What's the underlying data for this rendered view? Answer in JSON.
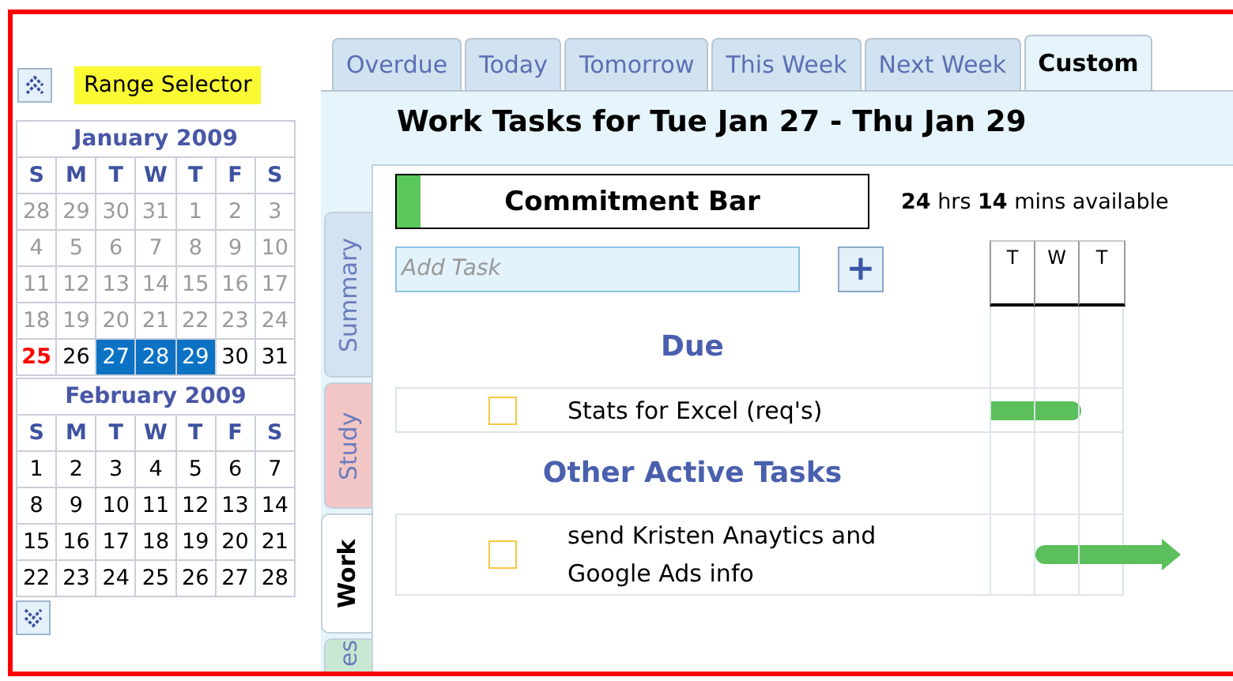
{
  "range_selector": {
    "label": "Range Selector"
  },
  "calendar": {
    "months": [
      {
        "title": "January 2009",
        "weekdays": [
          "S",
          "M",
          "T",
          "W",
          "T",
          "F",
          "S"
        ],
        "weeks": [
          [
            {
              "day": "28",
              "kind": "past",
              "selected": false
            },
            {
              "day": "29",
              "kind": "past",
              "selected": false
            },
            {
              "day": "30",
              "kind": "past",
              "selected": false
            },
            {
              "day": "31",
              "kind": "past",
              "selected": false
            },
            {
              "day": "1",
              "kind": "past",
              "selected": false
            },
            {
              "day": "2",
              "kind": "past",
              "selected": false
            },
            {
              "day": "3",
              "kind": "past",
              "selected": false
            }
          ],
          [
            {
              "day": "4",
              "kind": "past",
              "selected": false
            },
            {
              "day": "5",
              "kind": "past",
              "selected": false
            },
            {
              "day": "6",
              "kind": "past",
              "selected": false
            },
            {
              "day": "7",
              "kind": "past",
              "selected": false
            },
            {
              "day": "8",
              "kind": "past",
              "selected": false
            },
            {
              "day": "9",
              "kind": "past",
              "selected": false
            },
            {
              "day": "10",
              "kind": "past",
              "selected": false
            }
          ],
          [
            {
              "day": "11",
              "kind": "past",
              "selected": false
            },
            {
              "day": "12",
              "kind": "past",
              "selected": false
            },
            {
              "day": "13",
              "kind": "past",
              "selected": false
            },
            {
              "day": "14",
              "kind": "past",
              "selected": false
            },
            {
              "day": "15",
              "kind": "past",
              "selected": false
            },
            {
              "day": "16",
              "kind": "past",
              "selected": false
            },
            {
              "day": "17",
              "kind": "past",
              "selected": false
            }
          ],
          [
            {
              "day": "18",
              "kind": "past",
              "selected": false
            },
            {
              "day": "19",
              "kind": "past",
              "selected": false
            },
            {
              "day": "20",
              "kind": "past",
              "selected": false
            },
            {
              "day": "21",
              "kind": "past",
              "selected": false
            },
            {
              "day": "22",
              "kind": "past",
              "selected": false
            },
            {
              "day": "23",
              "kind": "past",
              "selected": false
            },
            {
              "day": "24",
              "kind": "past",
              "selected": false
            }
          ],
          [
            {
              "day": "25",
              "kind": "today",
              "selected": false
            },
            {
              "day": "26",
              "kind": "normal",
              "selected": false
            },
            {
              "day": "27",
              "kind": "normal",
              "selected": true
            },
            {
              "day": "28",
              "kind": "normal",
              "selected": true
            },
            {
              "day": "29",
              "kind": "normal",
              "selected": true
            },
            {
              "day": "30",
              "kind": "normal",
              "selected": false
            },
            {
              "day": "31",
              "kind": "normal",
              "selected": false
            }
          ]
        ]
      },
      {
        "title": "February 2009",
        "weekdays": [
          "S",
          "M",
          "T",
          "W",
          "T",
          "F",
          "S"
        ],
        "weeks": [
          [
            {
              "day": "1",
              "kind": "normal",
              "selected": false
            },
            {
              "day": "2",
              "kind": "normal",
              "selected": false
            },
            {
              "day": "3",
              "kind": "normal",
              "selected": false
            },
            {
              "day": "4",
              "kind": "normal",
              "selected": false
            },
            {
              "day": "5",
              "kind": "normal",
              "selected": false
            },
            {
              "day": "6",
              "kind": "normal",
              "selected": false
            },
            {
              "day": "7",
              "kind": "normal",
              "selected": false
            }
          ],
          [
            {
              "day": "8",
              "kind": "normal",
              "selected": false
            },
            {
              "day": "9",
              "kind": "normal",
              "selected": false
            },
            {
              "day": "10",
              "kind": "normal",
              "selected": false
            },
            {
              "day": "11",
              "kind": "normal",
              "selected": false
            },
            {
              "day": "12",
              "kind": "normal",
              "selected": false
            },
            {
              "day": "13",
              "kind": "normal",
              "selected": false
            },
            {
              "day": "14",
              "kind": "normal",
              "selected": false
            }
          ],
          [
            {
              "day": "15",
              "kind": "normal",
              "selected": false
            },
            {
              "day": "16",
              "kind": "normal",
              "selected": false
            },
            {
              "day": "17",
              "kind": "normal",
              "selected": false
            },
            {
              "day": "18",
              "kind": "normal",
              "selected": false
            },
            {
              "day": "19",
              "kind": "normal",
              "selected": false
            },
            {
              "day": "20",
              "kind": "normal",
              "selected": false
            },
            {
              "day": "21",
              "kind": "normal",
              "selected": false
            }
          ],
          [
            {
              "day": "22",
              "kind": "normal",
              "selected": false
            },
            {
              "day": "23",
              "kind": "normal",
              "selected": false
            },
            {
              "day": "24",
              "kind": "normal",
              "selected": false
            },
            {
              "day": "25",
              "kind": "normal",
              "selected": false
            },
            {
              "day": "26",
              "kind": "normal",
              "selected": false
            },
            {
              "day": "27",
              "kind": "normal",
              "selected": false
            },
            {
              "day": "28",
              "kind": "normal",
              "selected": false
            }
          ]
        ]
      }
    ]
  },
  "top_tabs": [
    {
      "label": "Overdue",
      "selected": false
    },
    {
      "label": "Today",
      "selected": false
    },
    {
      "label": "Tomorrow",
      "selected": false
    },
    {
      "label": "This Week",
      "selected": false
    },
    {
      "label": "Next Week",
      "selected": false
    },
    {
      "label": "Custom",
      "selected": true
    }
  ],
  "side_tabs": [
    {
      "label": "Summary",
      "color": "#d3e3f1",
      "selected": false
    },
    {
      "label": "Study",
      "color": "#f3c6c6",
      "selected": false
    },
    {
      "label": "Work",
      "color": "#ffffff",
      "selected": true
    },
    {
      "label": "es",
      "color": "#c8e8d3",
      "selected": false
    }
  ],
  "panel": {
    "title": "Work Tasks for Tue Jan 27 - Thu Jan 29",
    "commitment": {
      "label": "Commitment Bar",
      "level": 0.05
    },
    "availability": "**24** hrs **14** mins available",
    "add_task": {
      "placeholder": "Add Task"
    },
    "add_button": "+",
    "day_columns": [
      "T",
      "W",
      "T"
    ],
    "sections": [
      {
        "title": "Due",
        "tasks": [
          {
            "text": "Stats for Excel (req's)",
            "checked": false,
            "days": [
              true,
              true,
              false
            ],
            "continues": false
          }
        ]
      },
      {
        "title": "Other Active Tasks",
        "tasks": [
          {
            "text": "send Kristen Anaytics and Google Ads info",
            "checked": false,
            "days": [
              false,
              true,
              true
            ],
            "continues": true
          }
        ]
      }
    ]
  }
}
